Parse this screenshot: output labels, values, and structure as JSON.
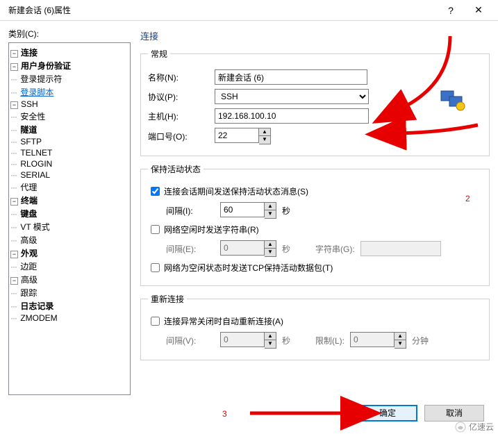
{
  "titlebar": {
    "title": "新建会话 (6)属性",
    "help": "?",
    "close": "✕"
  },
  "category_label": "类别(C):",
  "tree": [
    {
      "lvl": 1,
      "toggle": "−",
      "label": "连接",
      "bold": true
    },
    {
      "lvl": 2,
      "toggle": "−",
      "label": "用户身份验证",
      "bold": true
    },
    {
      "lvl": 3,
      "label": "登录提示符"
    },
    {
      "lvl": 3,
      "label": "登录脚本",
      "link": true
    },
    {
      "lvl": 2,
      "toggle": "−",
      "label": "SSH"
    },
    {
      "lvl": 3,
      "label": "安全性"
    },
    {
      "lvl": 3,
      "label": "隧道",
      "bold": true
    },
    {
      "lvl": 3,
      "label": "SFTP"
    },
    {
      "lvl": 2,
      "label": "TELNET"
    },
    {
      "lvl": 2,
      "label": "RLOGIN"
    },
    {
      "lvl": 2,
      "label": "SERIAL"
    },
    {
      "lvl": 2,
      "label": "代理"
    },
    {
      "lvl": 1,
      "toggle": "−",
      "label": "终端",
      "bold": true
    },
    {
      "lvl": 2,
      "label": "键盘",
      "bold": true
    },
    {
      "lvl": 2,
      "label": "VT 模式"
    },
    {
      "lvl": 2,
      "label": "高级"
    },
    {
      "lvl": 1,
      "toggle": "−",
      "label": "外观",
      "bold": true
    },
    {
      "lvl": 2,
      "label": "边距"
    },
    {
      "lvl": 1,
      "toggle": "−",
      "label": "高级"
    },
    {
      "lvl": 2,
      "label": "跟踪"
    },
    {
      "lvl": 2,
      "label": "日志记录",
      "bold": true
    },
    {
      "lvl": 2,
      "label": "ZMODEM"
    }
  ],
  "right_title": "连接",
  "general": {
    "legend": "常规",
    "name_label": "名称(N):",
    "name_value": "新建会话 (6)",
    "proto_label": "协议(P):",
    "proto_value": "SSH",
    "host_label": "主机(H):",
    "host_value": "192.168.100.10",
    "port_label": "端口号(O):",
    "port_value": "22"
  },
  "keepalive": {
    "legend": "保持活动状态",
    "send_msg_label": "连接会话期间发送保持活动状态消息(S)",
    "interval_i_label": "间隔(I):",
    "interval_i_value": "60",
    "sec": "秒",
    "send_string_label": "网络空闲时发送字符串(R)",
    "interval_e_label": "间隔(E):",
    "interval_e_value": "0",
    "string_label": "字符串(G):",
    "tcp_label": "网络为空闲状态时发送TCP保持活动数据包(T)"
  },
  "reconnect": {
    "legend": "重新连接",
    "auto_label": "连接异常关闭时自动重新连接(A)",
    "interval_v_label": "间隔(V):",
    "interval_v_value": "0",
    "limit_label": "限制(L):",
    "limit_value": "0",
    "min": "分钟",
    "sec": "秒"
  },
  "buttons": {
    "ok": "确定",
    "cancel": "取消"
  },
  "annot": {
    "two": "2",
    "three": "3"
  },
  "watermark": "亿速云"
}
